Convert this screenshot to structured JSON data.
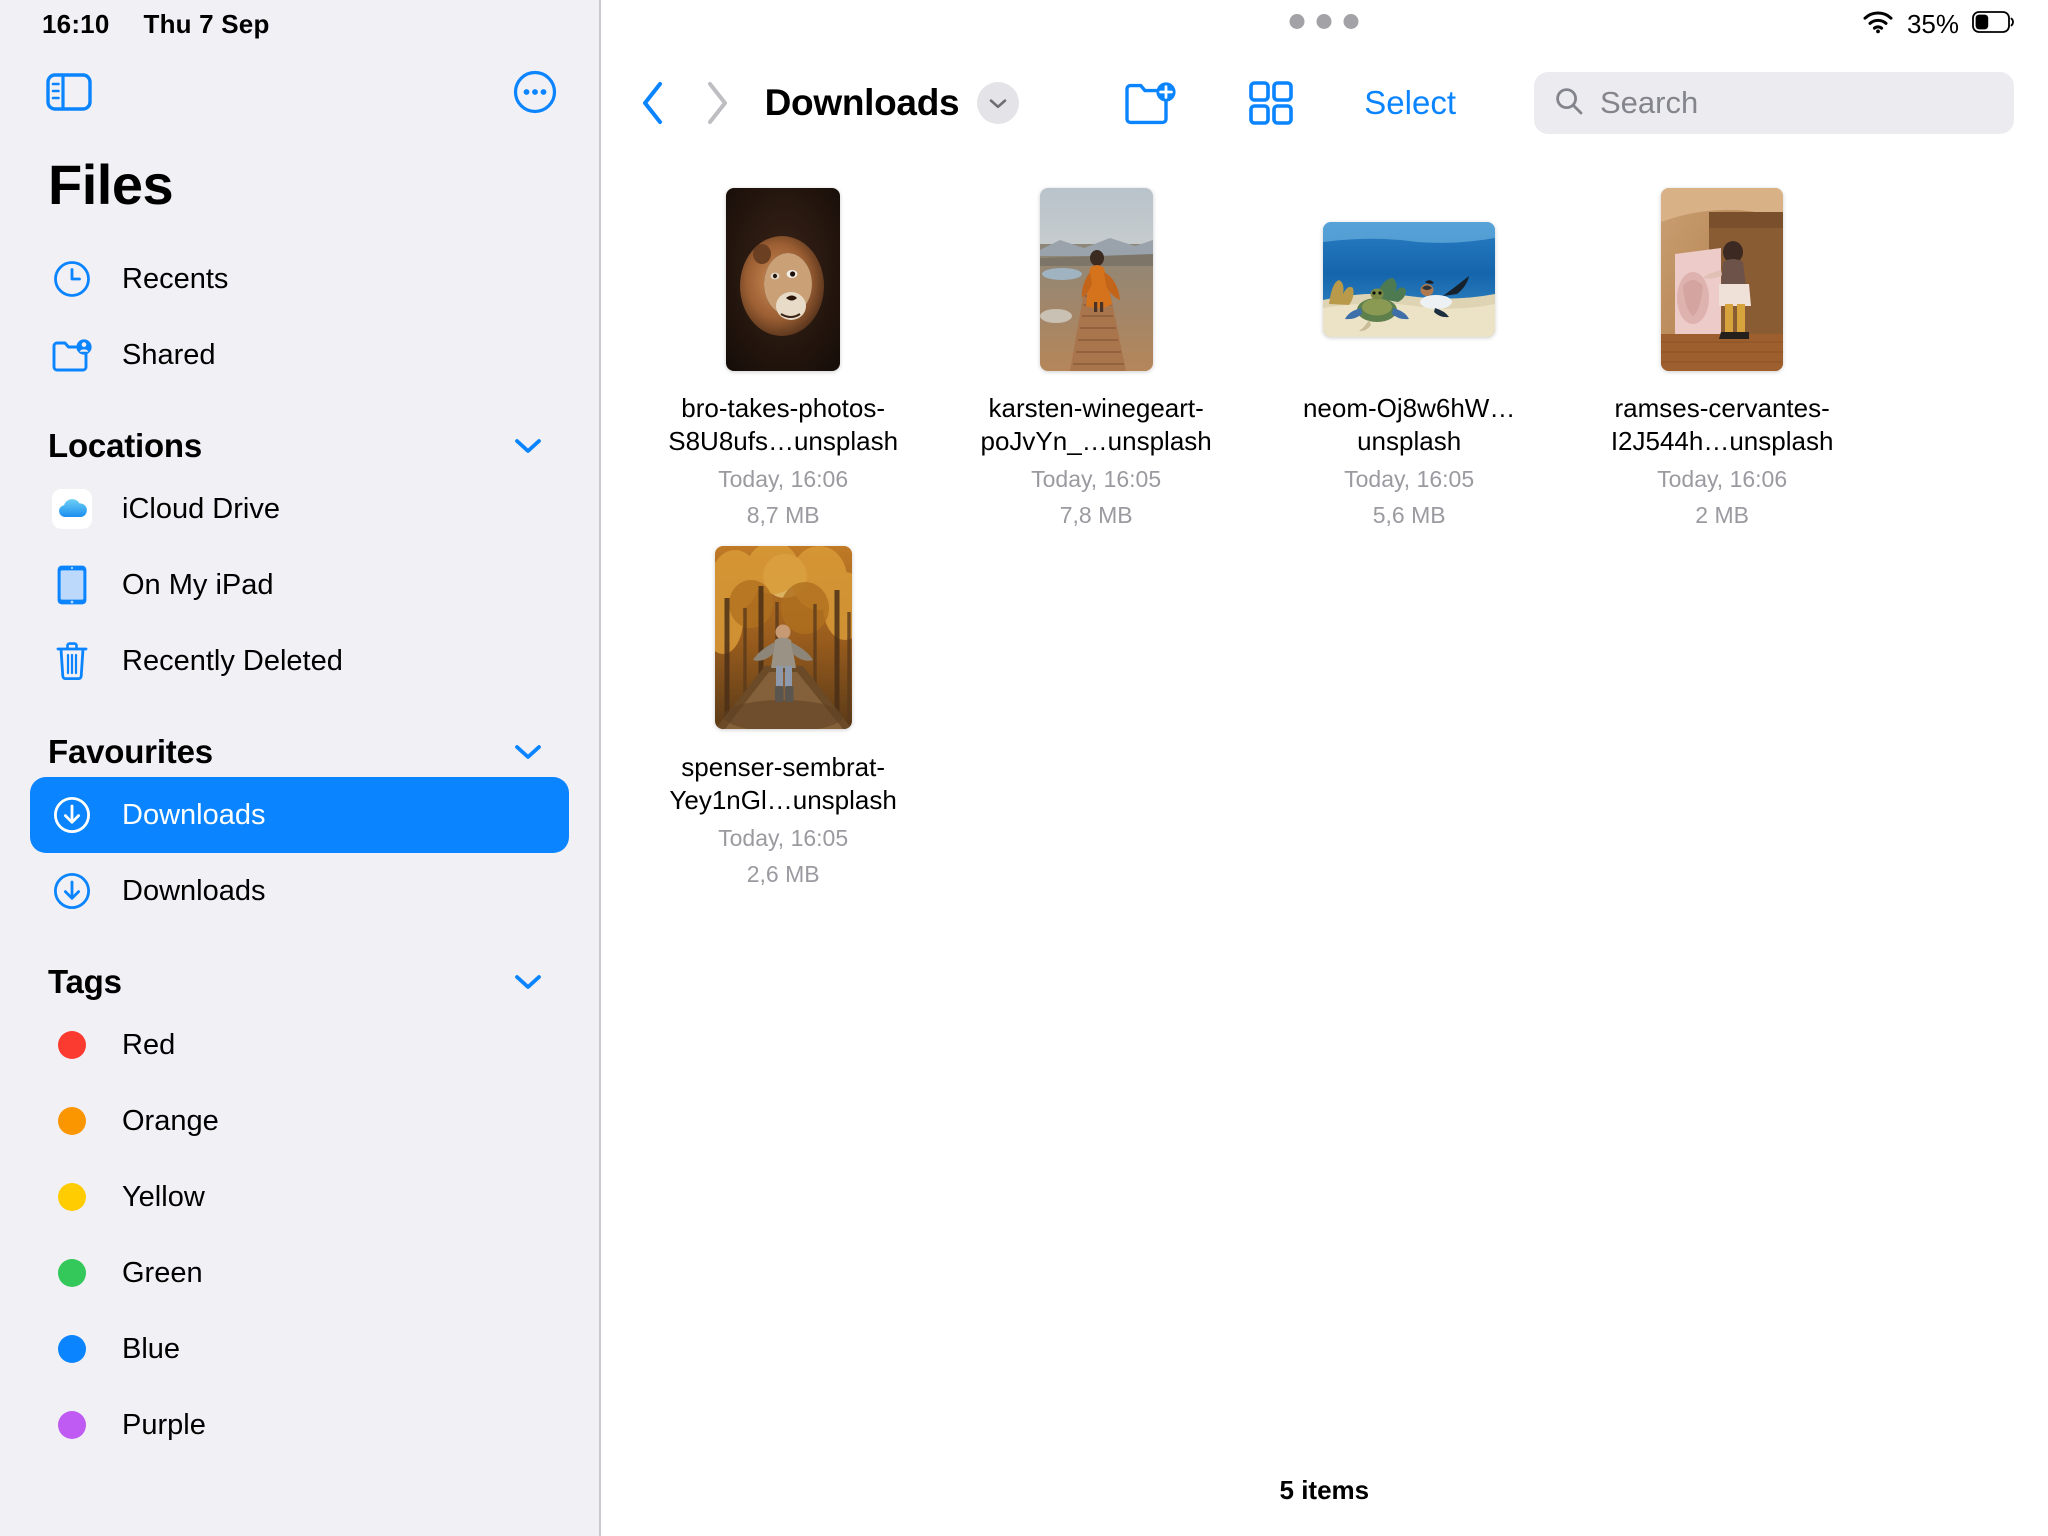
{
  "status_bar": {
    "time": "16:10",
    "date": "Thu 7 Sep",
    "battery_percent": "35%",
    "wifi_icon": "wifi-icon",
    "battery_icon": "battery-icon"
  },
  "sidebar": {
    "app_title": "Files",
    "toggle_icon": "sidebar-toggle-icon",
    "more_icon": "more-ellipsis-icon",
    "quick_items": [
      {
        "label": "Recents",
        "icon": "clock-icon"
      },
      {
        "label": "Shared",
        "icon": "shared-folder-icon"
      }
    ],
    "sections": [
      {
        "title": "Locations",
        "collapse_icon": "chevron-down-icon",
        "items": [
          {
            "label": "iCloud Drive",
            "icon": "icloud-drive-icon"
          },
          {
            "label": "On My iPad",
            "icon": "ipad-icon"
          },
          {
            "label": "Recently Deleted",
            "icon": "trash-icon"
          }
        ]
      },
      {
        "title": "Favourites",
        "collapse_icon": "chevron-down-icon",
        "items": [
          {
            "label": "Downloads",
            "icon": "download-circle-icon",
            "selected": true
          },
          {
            "label": "Downloads",
            "icon": "download-circle-icon",
            "selected": false
          }
        ]
      },
      {
        "title": "Tags",
        "collapse_icon": "chevron-down-icon",
        "items": [
          {
            "label": "Red",
            "icon": "tag-dot-icon",
            "color": "#fb3b30"
          },
          {
            "label": "Orange",
            "icon": "tag-dot-icon",
            "color": "#fb9500"
          },
          {
            "label": "Yellow",
            "icon": "tag-dot-icon",
            "color": "#ffcc02"
          },
          {
            "label": "Green",
            "icon": "tag-dot-icon",
            "color": "#34c759"
          },
          {
            "label": "Blue",
            "icon": "tag-dot-icon",
            "color": "#0a84ff"
          },
          {
            "label": "Purple",
            "icon": "tag-dot-icon",
            "color": "#bf5af2"
          }
        ]
      }
    ]
  },
  "toolbar": {
    "back_icon": "chevron-left-icon",
    "forward_icon": "chevron-right-icon",
    "folder_title": "Downloads",
    "title_dropdown_icon": "chevron-down-icon",
    "new_folder_icon": "new-folder-icon",
    "view_grid_icon": "grid-view-icon",
    "select_label": "Select",
    "search_placeholder": "Search",
    "search_value": "",
    "search_icon": "search-icon"
  },
  "files": [
    {
      "name": "bro-takes-photos-S8U8ufs…unsplash",
      "date": "Today, 16:06",
      "size": "8,7 MB",
      "orientation": "portrait",
      "thumb_desc": "lion-portrait-dark"
    },
    {
      "name": "karsten-winegeart-poJvYn_…unsplash",
      "date": "Today, 16:05",
      "size": "7,8 MB",
      "orientation": "portrait",
      "thumb_desc": "woman-orange-dress-boardwalk"
    },
    {
      "name": "neom-Oj8w6hW…unsplash",
      "date": "Today, 16:05",
      "size": "5,6 MB",
      "orientation": "landscape",
      "thumb_desc": "underwater-turtle-diver"
    },
    {
      "name": "ramses-cervantes-I2J544h…unsplash",
      "date": "Today, 16:06",
      "size": "2 MB",
      "orientation": "portrait",
      "thumb_desc": "person-pink-wall-interior"
    },
    {
      "name": "spenser-sembrat-Yey1nGl…unsplash",
      "date": "Today, 16:05",
      "size": "2,6 MB",
      "orientation": "portrait",
      "thumb_desc": "autumn-forest-path"
    }
  ],
  "footer": {
    "item_count_label": "5 items"
  },
  "colors": {
    "accent": "#0a84ff",
    "sidebar_bg": "#f0f0f5",
    "content_bg": "#ffffff",
    "secondary_text": "#9a9aa0"
  }
}
